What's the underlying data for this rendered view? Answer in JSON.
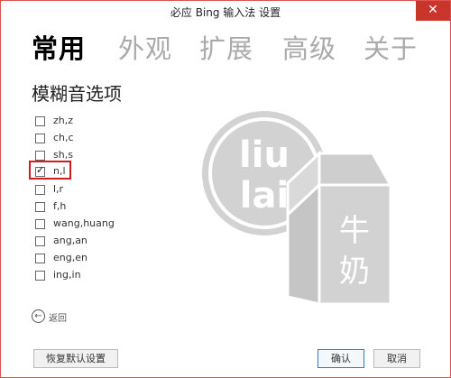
{
  "window": {
    "title": "必应 Bing 输入法 设置",
    "close_glyph": "✕"
  },
  "tabs": [
    {
      "label": "常用",
      "active": true
    },
    {
      "label": "外观",
      "active": false
    },
    {
      "label": "扩展",
      "active": false
    },
    {
      "label": "高级",
      "active": false
    },
    {
      "label": "关于",
      "active": false
    }
  ],
  "section_title": "模糊音选项",
  "options": [
    {
      "label": "zh,z",
      "checked": false
    },
    {
      "label": "ch,c",
      "checked": false
    },
    {
      "label": "sh,s",
      "checked": false
    },
    {
      "label": "n,l",
      "checked": true
    },
    {
      "label": "l,r",
      "checked": false
    },
    {
      "label": "f,h",
      "checked": false
    },
    {
      "label": "wang,huang",
      "checked": false
    },
    {
      "label": "ang,an",
      "checked": false
    },
    {
      "label": "eng,en",
      "checked": false
    },
    {
      "label": "ing,in",
      "checked": false
    }
  ],
  "checkmark_glyph": "✓",
  "back": {
    "label": "返回",
    "icon_glyph": "←"
  },
  "logo": {
    "word_top": "liu",
    "word_bottom": "lai",
    "carton_char_1": "牛",
    "carton_char_2": "奶"
  },
  "buttons": {
    "restore": "恢复默认设置",
    "confirm": "确认",
    "cancel": "取消"
  },
  "colors": {
    "close_red": "#c7352b",
    "highlight_red": "#d01c1c",
    "logo_gray": "#d2d2d2",
    "primary_border": "#2c79c4"
  }
}
